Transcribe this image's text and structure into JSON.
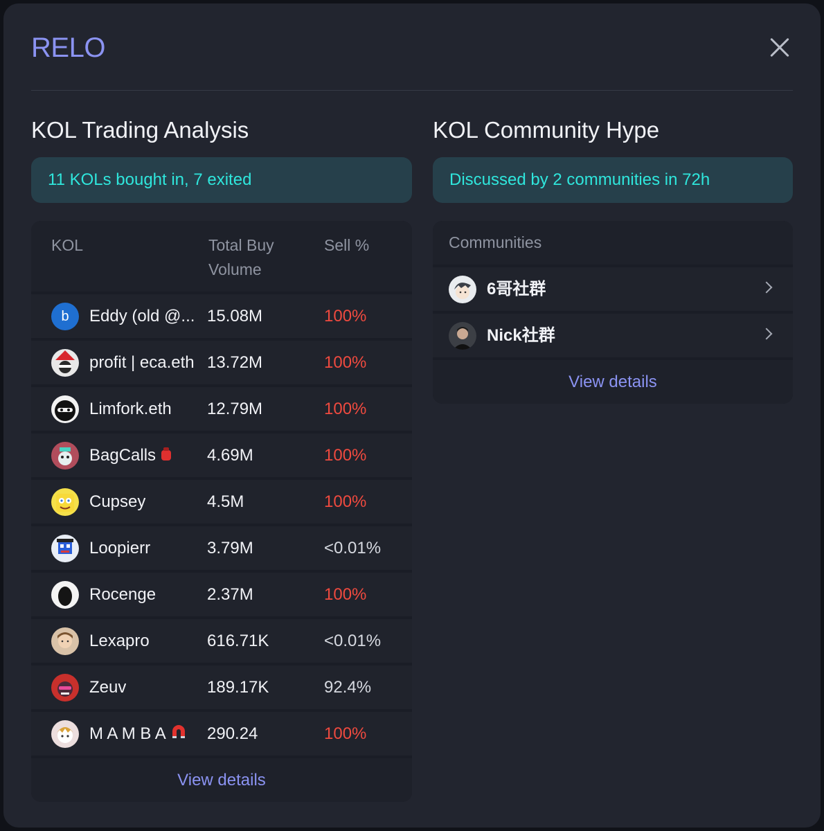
{
  "modal": {
    "title": "RELO"
  },
  "trading": {
    "heading": "KOL Trading Analysis",
    "summary": "11 KOLs bought in, 7 exited",
    "columns": {
      "kol": "KOL",
      "volume_line1": "Total Buy",
      "volume_line2": "Volume",
      "sell": "Sell %"
    },
    "rows": [
      {
        "name": "Eddy (old @...",
        "volume": "15.08M",
        "sell": "100%",
        "sell_status": "red",
        "avatar": "letter-b-avatar",
        "avatar_letter": "b"
      },
      {
        "name": "profit | eca.eth",
        "volume": "13.72M",
        "sell": "100%",
        "sell_status": "red",
        "avatar": "santa-hat-avatar"
      },
      {
        "name": "Limfork.eth",
        "volume": "12.79M",
        "sell": "100%",
        "sell_status": "red",
        "avatar": "ninja-avatar"
      },
      {
        "name": "BagCalls",
        "volume": "4.69M",
        "sell": "100%",
        "sell_status": "red",
        "avatar": "cartoon-avatar",
        "badge": "red-bag-emoji"
      },
      {
        "name": "Cupsey",
        "volume": "4.5M",
        "sell": "100%",
        "sell_status": "red",
        "avatar": "sponge-avatar"
      },
      {
        "name": "Loopierr",
        "volume": "3.79M",
        "sell": "<0.01%",
        "sell_status": "neutral",
        "avatar": "pixel-avatar"
      },
      {
        "name": "Rocenge",
        "volume": "2.37M",
        "sell": "100%",
        "sell_status": "red",
        "avatar": "dark-silhouette-avatar"
      },
      {
        "name": "Lexapro",
        "volume": "616.71K",
        "sell": "<0.01%",
        "sell_status": "neutral",
        "avatar": "portrait-avatar"
      },
      {
        "name": "Zeuv",
        "volume": "189.17K",
        "sell": "92.4%",
        "sell_status": "neutral",
        "avatar": "red-cartoon-avatar"
      },
      {
        "name": "M A M B A",
        "volume": "290.24",
        "sell": "100%",
        "sell_status": "red",
        "avatar": "anime-avatar",
        "badge": "magnet-emoji"
      }
    ],
    "view_details": "View details"
  },
  "community": {
    "heading": "KOL Community Hype",
    "summary": "Discussed by 2 communities in 72h",
    "column": "Communities",
    "rows": [
      {
        "name": "6哥社群",
        "avatar": "anime-boy-avatar"
      },
      {
        "name": "Nick社群",
        "avatar": "man-portrait-avatar"
      }
    ],
    "view_details": "View details"
  },
  "colors": {
    "accent": "#8b93f2",
    "teal": "#2fe6dc",
    "red": "#ef4a3f",
    "panel": "#22252f"
  }
}
